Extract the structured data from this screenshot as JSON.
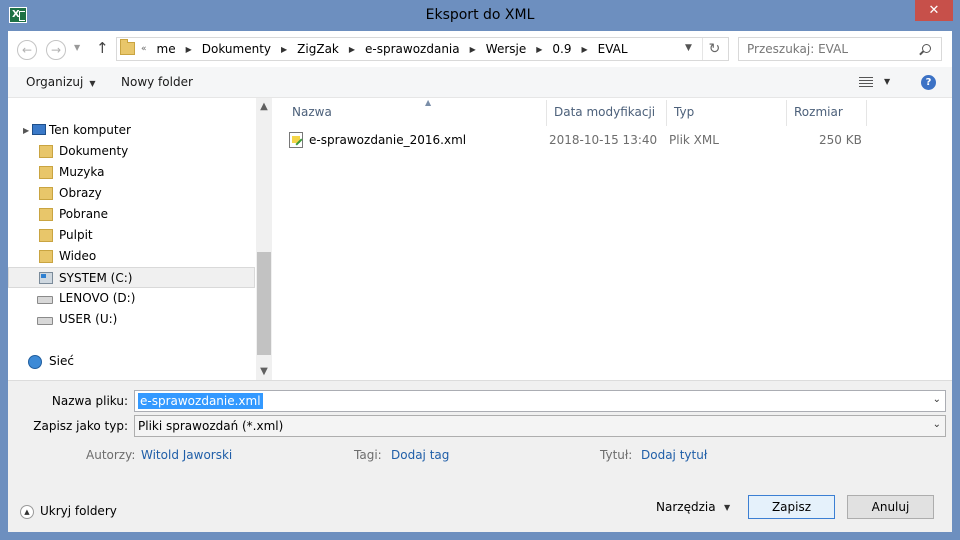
{
  "window": {
    "title": "Eksport do XML",
    "close_glyph": "✕"
  },
  "addressbar": {
    "back_glyph": "←",
    "forward_glyph": "→",
    "up_glyph": "↑",
    "overflow": "«",
    "crumbs": [
      "me",
      "Dokumenty",
      "ZigZak",
      "e-sprawozdania",
      "Wersje",
      "0.9",
      "EVAL"
    ],
    "refresh_glyph": "↻"
  },
  "search": {
    "placeholder": "Przeszukaj: EVAL"
  },
  "commandbar": {
    "organize_label": "Organizuj",
    "new_folder_label": "Nowy folder",
    "help_glyph": "?"
  },
  "navpane": {
    "computer": "Ten komputer",
    "items": [
      "Dokumenty",
      "Muzyka",
      "Obrazy",
      "Pobrane",
      "Pulpit",
      "Wideo"
    ],
    "drives": [
      "SYSTEM (C:)",
      "LENOVO (D:)",
      "USER (U:)"
    ],
    "network": "Sieć",
    "selected": "SYSTEM (C:)"
  },
  "filelist": {
    "columns": [
      "Nazwa",
      "Data modyfikacji",
      "Typ",
      "Rozmiar"
    ],
    "rows": [
      {
        "name": "e-sprawozdanie_2016.xml",
        "modified": "2018-10-15 13:40",
        "type": "Plik XML",
        "size": "250 KB"
      }
    ]
  },
  "form": {
    "filename_label": "Nazwa pliku:",
    "filename_value": "e-sprawozdanie.xml",
    "filetype_label": "Zapisz jako typ:",
    "filetype_value": "Pliki sprawozdań (*.xml)",
    "authors_label": "Autorzy:",
    "authors_value": "Witold Jaworski",
    "tags_label": "Tagi:",
    "tags_value": "Dodaj tag",
    "title_label": "Tytuł:",
    "title_value": "Dodaj tytuł"
  },
  "footer": {
    "hide_folders_label": "Ukryj foldery",
    "tools_label": "Narzędzia",
    "save_label": "Zapisz",
    "cancel_label": "Anuluj"
  },
  "colors": {
    "window_frame": "#6d8fbf",
    "close_button": "#c7504a",
    "link_blue": "#1f5ea8",
    "selection": "#3399ff"
  }
}
